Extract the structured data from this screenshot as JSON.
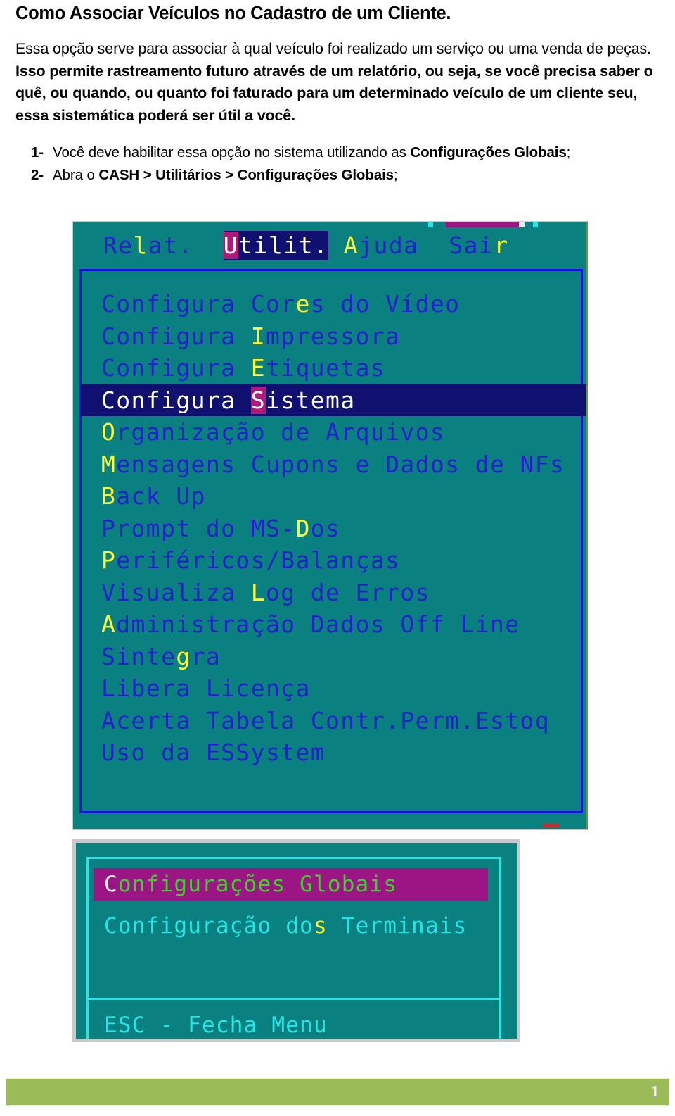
{
  "document": {
    "title": "Como Associar Veículos no Cadastro de um Cliente.",
    "intro_html": "Essa opção serve para associar à qual veículo foi realizado um serviço ou uma venda de peças. <b>Isso permite rastreamento futuro através de um relatório, ou seja, se você precisa saber o quê, ou quando, ou quanto foi faturado para um determinado veículo de um cliente seu, essa sistemática poderá ser útil a você.</b>",
    "steps": [
      {
        "number": "1-",
        "html": "Você deve habilitar essa opção no sistema utilizando as <b>Configurações Globais</b>;"
      },
      {
        "number": "2-",
        "html": "Abra o <b>CASH &gt; Utilitários &gt; Configurações Globais</b>;"
      }
    ],
    "page_number": "1"
  },
  "screenshot_utilitarios": {
    "menubar": [
      {
        "label": "Relat.",
        "hotkey_index": 2,
        "active": false
      },
      {
        "label": "Utilit.",
        "hotkey_index": 0,
        "active": true
      },
      {
        "label": "Ajuda",
        "hotkey_index": 0,
        "active": false
      },
      {
        "label": "Sair",
        "hotkey_index": 3,
        "active": false
      }
    ],
    "menu_items": [
      {
        "label": "Configura Cores do Vídeo",
        "hotkey_index": 13,
        "selected": false
      },
      {
        "label": "Configura Impressora",
        "hotkey_index": 10,
        "selected": false
      },
      {
        "label": "Configura Etiquetas",
        "hotkey_index": 10,
        "selected": false
      },
      {
        "label": "Configura Sistema",
        "hotkey_index": 10,
        "selected": true
      },
      {
        "label": "Organização de Arquivos",
        "hotkey_index": 0,
        "selected": false
      },
      {
        "label": "Mensagens Cupons e Dados de NFs",
        "hotkey_index": 0,
        "selected": false
      },
      {
        "label": "Back Up",
        "hotkey_index": 0,
        "selected": false
      },
      {
        "label": "Prompt do MS-Dos",
        "hotkey_index": 13,
        "selected": false
      },
      {
        "label": "Periféricos/Balanças",
        "hotkey_index": 0,
        "selected": false
      },
      {
        "label": "Visualiza Log de Erros",
        "hotkey_index": 10,
        "selected": false
      },
      {
        "label": "Administração Dados Off Line",
        "hotkey_index": 0,
        "selected": false
      },
      {
        "label": "Sintegra",
        "hotkey_index": 5,
        "selected": false
      },
      {
        "label": "Libera Licença",
        "hotkey_index": -1,
        "selected": false
      },
      {
        "label": "Acerta Tabela Contr.Perm.Estoq",
        "hotkey_index": -1,
        "selected": false
      },
      {
        "label": "Uso da ESSystem",
        "hotkey_index": -1,
        "selected": false
      }
    ],
    "colors": {
      "background": "#0a8080",
      "text": "#2222cc",
      "hotkey": "#ffff33",
      "selected_background": "#101070",
      "selected_text": "#ffffff",
      "hotkey_highlight_background": "#b0197a",
      "border": "#1212d8"
    }
  },
  "screenshot_configuracoes": {
    "items": [
      {
        "label": "Configurações Globais",
        "hotkey_index": 0,
        "selected": true
      },
      {
        "label": "Configuração dos Terminais",
        "hotkey_index": 15,
        "selected": false
      }
    ],
    "footer": "ESC - Fecha Menu",
    "colors": {
      "background": "#0a8080",
      "text": "#25e6e6",
      "hotkey": "#ffff33",
      "selected_background": "#9c1585",
      "selected_text": "#3fd12b",
      "selected_hotkey": "#ffffff",
      "border": "#25e6e6",
      "frame": "#c9c9c9"
    }
  },
  "footer": {
    "bar_color": "#9bbb59",
    "page_number": "1"
  }
}
